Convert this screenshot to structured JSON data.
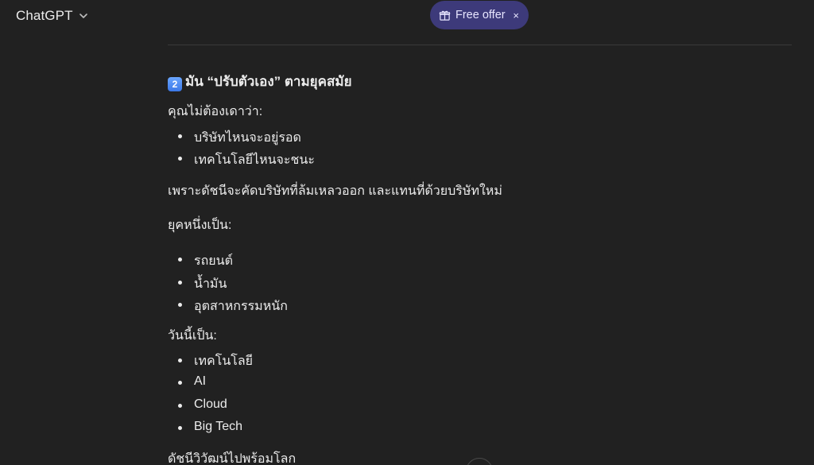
{
  "topbar": {
    "model_name": "ChatGPT",
    "offer_label": "Free offer",
    "offer_close": "×"
  },
  "message": {
    "heading_number": "2",
    "heading_text": "มัน “ปรับตัวเอง” ตามยุคสมัย",
    "intro": "คุณไม่ต้องเดาว่า:",
    "guess_items": [
      "บริษัทไหนจะอยู่รอด",
      "เทคโนโลยีไหนจะชนะ"
    ],
    "reason": "เพราะดัชนีจะคัดบริษัทที่ล้มเหลวออก และแทนที่ด้วยบริษัทใหม่",
    "era_past_label": "ยุคหนึ่งเป็น:",
    "era_past_items": [
      "รถยนต์",
      "น้ำมัน",
      "อุตสาหกรรมหนัก"
    ],
    "era_now_label": "วันนี้เป็น:",
    "era_now_items": [
      "เทคโนโลยี",
      "AI",
      "Cloud",
      "Big Tech"
    ],
    "closing": "ดัชนีวิวัฒน์ไปพร้อมโลก"
  },
  "icons": {
    "chevron": "chevron-down-icon",
    "gift": "gift-icon",
    "close": "close-icon",
    "scroll": "scroll-down-icon"
  },
  "colors": {
    "background": "#212121",
    "text": "#ececec",
    "offer_pill": "#3d3a7a"
  }
}
